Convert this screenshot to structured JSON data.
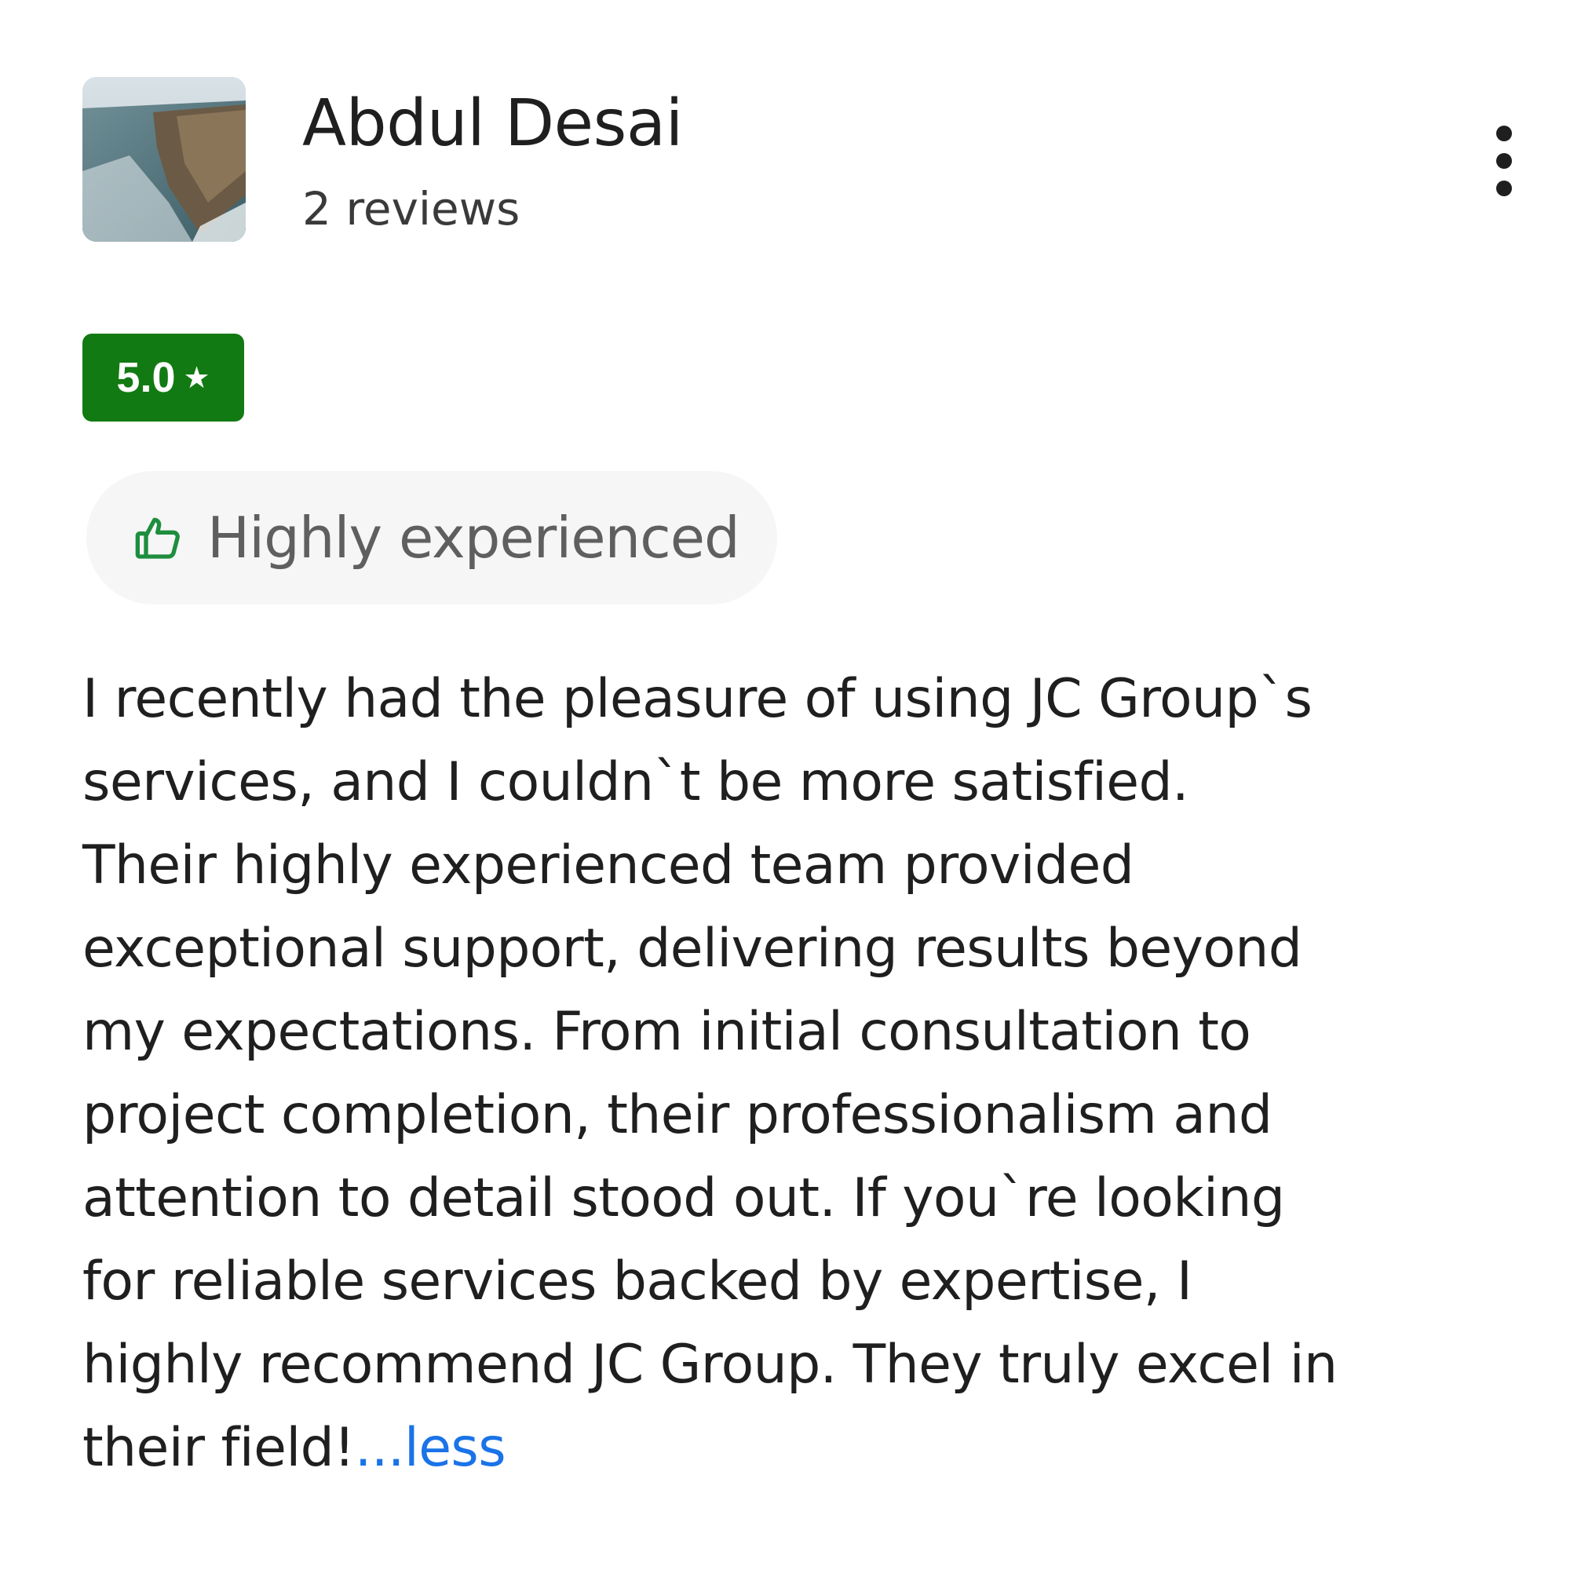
{
  "reviewer": {
    "name": "Abdul Desai",
    "review_count": "2 reviews",
    "avatar_icon": "landscape-cliff-photo"
  },
  "menu": {
    "icon": "more-vert-icon"
  },
  "rating": {
    "value": "5.0",
    "star": "★",
    "badge_color": "#127a12"
  },
  "highlight": {
    "icon": "thumbs-up-icon",
    "icon_color": "#1e8e3e",
    "label": "Highly experienced"
  },
  "review": {
    "lines": [
      "I recently had the pleasure of using JC Group`s",
      "services, and I couldn`t be more satisfied.",
      "Their highly experienced team provided",
      "exceptional support, delivering results beyond",
      "my expectations. From initial consultation to",
      "project completion, their professionalism and",
      "attention to detail stood out. If you`re looking",
      "for reliable services backed by expertise, I",
      "highly recommend JC Group. They truly excel in",
      "their field!"
    ],
    "less_link": "...less",
    "link_color": "#1a73e8"
  }
}
